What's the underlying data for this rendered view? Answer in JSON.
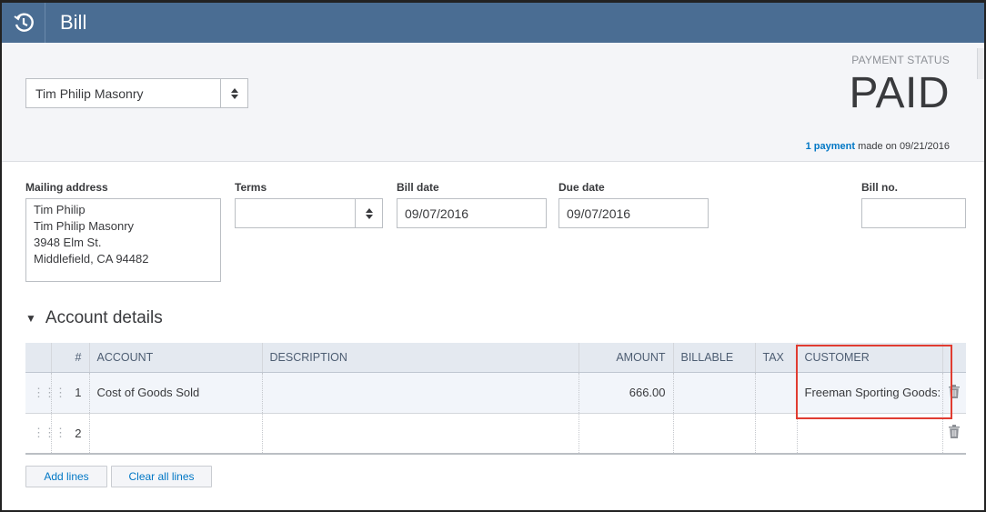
{
  "window": {
    "title": "Bill"
  },
  "header": {
    "vendor": "Tim Philip Masonry",
    "payment_status_label": "PAYMENT STATUS",
    "payment_status_value": "PAID",
    "payment_link": "1 payment",
    "payment_note": "made on 09/21/2016"
  },
  "form": {
    "mailing_address_label": "Mailing address",
    "mailing_address": [
      "Tim Philip",
      "Tim Philip Masonry",
      "3948 Elm St.",
      "Middlefield, CA  94482"
    ],
    "terms_label": "Terms",
    "terms_value": "",
    "bill_date_label": "Bill date",
    "bill_date": "09/07/2016",
    "due_date_label": "Due date",
    "due_date": "09/07/2016",
    "bill_no_label": "Bill no.",
    "bill_no": ""
  },
  "account_details": {
    "title": "Account details",
    "columns": [
      "#",
      "ACCOUNT",
      "DESCRIPTION",
      "AMOUNT",
      "BILLABLE",
      "TAX",
      "CUSTOMER"
    ],
    "rows": [
      {
        "num": "1",
        "account": "Cost of Goods Sold",
        "description": "",
        "amount": "666.00",
        "billable": "",
        "tax": "",
        "customer": "Freeman Sporting Goods:"
      },
      {
        "num": "2",
        "account": "",
        "description": "",
        "amount": "",
        "billable": "",
        "tax": "",
        "customer": ""
      }
    ]
  },
  "buttons": {
    "add_lines": "Add lines",
    "clear_all_lines": "Clear all lines"
  },
  "colors": {
    "titlebar": "#4a6d93",
    "link": "#0077c5",
    "highlight": "#e03c31"
  }
}
